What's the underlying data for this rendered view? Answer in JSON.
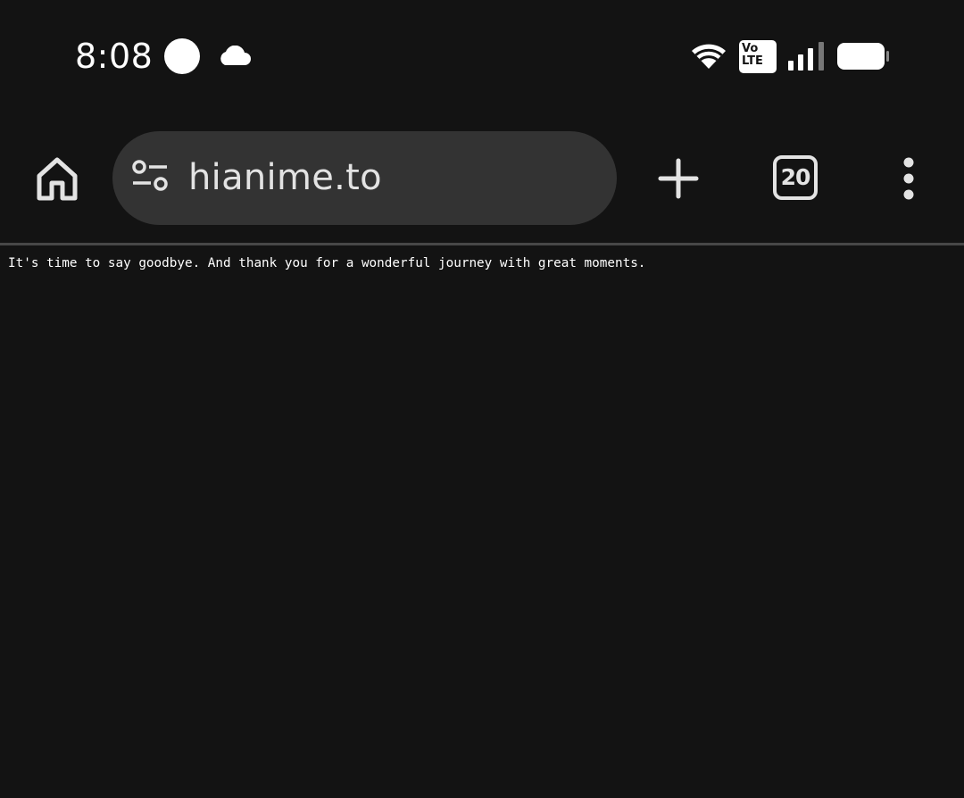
{
  "status_bar": {
    "time": "8:08",
    "icons": [
      "notification-dot-icon",
      "cloud-icon",
      "wifi-icon",
      "volte-icon",
      "cell-signal-icon",
      "battery-icon"
    ],
    "volte_line1": "Vo",
    "volte_line2": "LTE"
  },
  "toolbar": {
    "home_icon": "home-icon",
    "site_settings_icon": "tune-icon",
    "url": "hianime.to",
    "new_tab_icon": "plus-icon",
    "tab_count": "20",
    "menu_icon": "more-vert-icon"
  },
  "page": {
    "message": "It's time to say goodbye. And thank you for a wonderful journey with great moments."
  },
  "colors": {
    "background": "#131313",
    "omnibox": "#333333",
    "icon": "#e3e3e3",
    "divider": "#474747",
    "text": "#ffffff"
  }
}
